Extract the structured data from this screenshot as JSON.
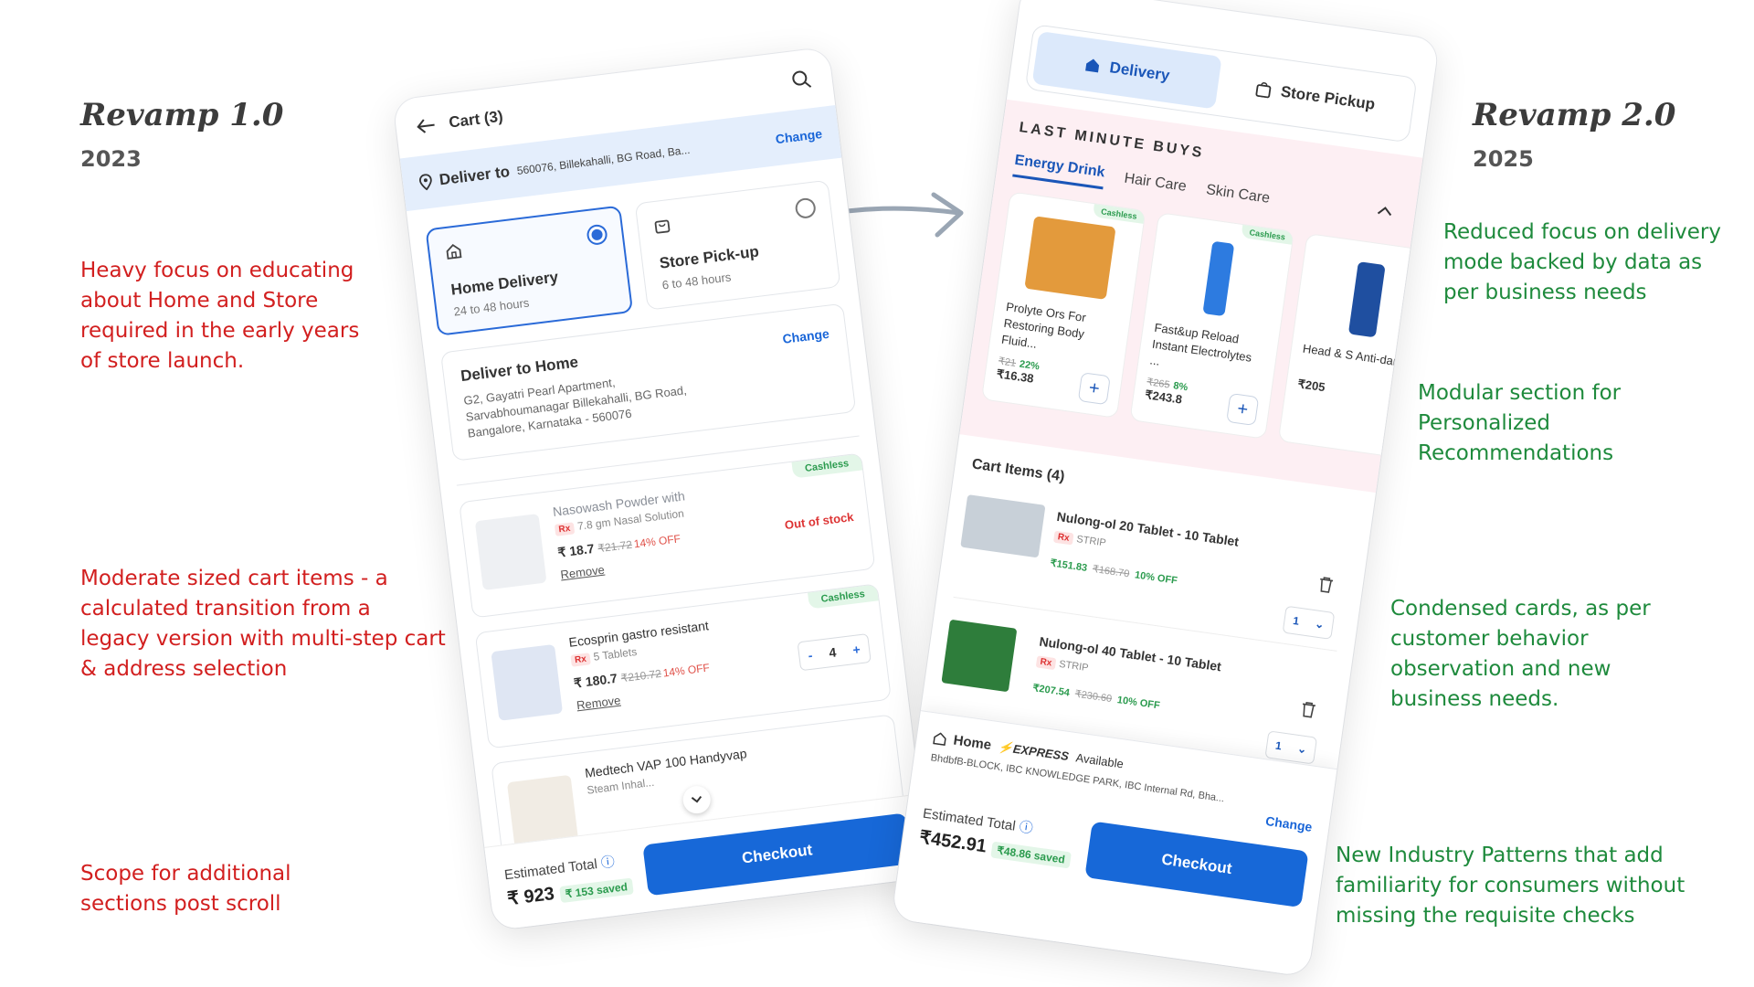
{
  "left_panel": {
    "title": "Revamp 1.0",
    "year": "2023",
    "notes": [
      "Heavy focus on educating about Home and Store required in the early years of store launch.",
      "Moderate sized cart items - a calculated transition from a legacy version with multi-step cart & address selection",
      "Scope for additional sections post scroll"
    ]
  },
  "right_panel": {
    "title": "Revamp 2.0",
    "year": "2025",
    "notes": [
      "Reduced focus on delivery mode backed by data as per business needs",
      "Modular section for Personalized Recommendations",
      "Condensed cards, as per customer behavior observation and new business needs.",
      "New Industry Patterns that add familiarity for consumers without missing the requisite checks"
    ]
  },
  "phone_v1": {
    "header_title": "Cart (3)",
    "deliver_label": "Deliver to",
    "deliver_address": "560076, Billekahalli, BG Road, Ba...",
    "change_label": "Change",
    "modes": [
      {
        "name": "Home Delivery",
        "hours": "24 to 48 hours",
        "selected": true
      },
      {
        "name": "Store Pick-up",
        "hours": "6 to 48 hours",
        "selected": false
      }
    ],
    "home_card": {
      "title": "Deliver to Home",
      "address": "G2, Gayatri Pearl Apartment, Sarvabhoumanagar Billekahalli, BG Road, Bangalore, Karnataka - 560076",
      "change_label": "Change"
    },
    "items": [
      {
        "tag": "Cashless",
        "name": "Nasowash Powder with",
        "sub": "7.8 gm Nasal Solution",
        "price": "₹ 18.7",
        "mrp": "₹21.72",
        "off": "14% OFF",
        "status": "Out of stock",
        "remove": "Remove"
      },
      {
        "tag": "Cashless",
        "name": "Ecosprin gastro resistant",
        "sub": "5 Tablets",
        "price": "₹ 180.7",
        "mrp": "₹210.72",
        "off": "14% OFF",
        "qty": "4",
        "remove": "Remove"
      },
      {
        "name": "Medtech VAP 100 Handyvap",
        "sub": "Steam Inhal..."
      }
    ],
    "footer": {
      "label": "Estimated Total",
      "total": "₹ 923",
      "saved": "₹ 153 saved",
      "checkout": "Checkout"
    }
  },
  "phone_v2": {
    "toggle": [
      "Delivery",
      "Store Pickup"
    ],
    "lmb_title": "LAST MINUTE BUYS",
    "tabs": [
      "Energy Drink",
      "Hair Care",
      "Skin Care"
    ],
    "products": [
      {
        "tag": "Cashless",
        "name": "Prolyte Ors For Restoring Body Fluid...",
        "mrp": "₹21",
        "off": "22%",
        "price": "₹16.38",
        "color": "#e39a3c"
      },
      {
        "tag": "Cashless",
        "name": "Fast&up Reload Instant Electrolytes ...",
        "mrp": "₹265",
        "off": "8%",
        "price": "₹243.8",
        "color": "#2d7be0"
      },
      {
        "name": "Head & S Anti-dan",
        "price": "₹205",
        "color": "#1f4fa0"
      }
    ],
    "cart_heading": "Cart Items (4)",
    "cart_items": [
      {
        "name": "Nulong-ol 20 Tablet - 10 Tablet",
        "sub": "STRIP",
        "price": "₹151.83",
        "mrp": "₹168.70",
        "off": "10% OFF",
        "qty": "1",
        "color": "#c8d0d8"
      },
      {
        "name": "Nulong-ol 40 Tablet - 10 Tablet",
        "sub": "STRIP",
        "price": "₹207.54",
        "mrp": "₹230.60",
        "off": "10% OFF",
        "qty": "1",
        "color": "#2e7d3b"
      }
    ],
    "footer": {
      "home": "Home",
      "express": "EXPRESS",
      "available": "Available",
      "address": "BhdbfB-BLOCK, IBC KNOWLEDGE PARK, IBC Internal Rd, Bha...",
      "change": "Change",
      "label": "Estimated Total",
      "total": "₹452.91",
      "saved": "₹48.86 saved",
      "checkout": "Checkout"
    }
  },
  "colors": {
    "red_note": "#d21f1f",
    "green_note": "#1e8a3c",
    "primary": "#1768d8"
  }
}
